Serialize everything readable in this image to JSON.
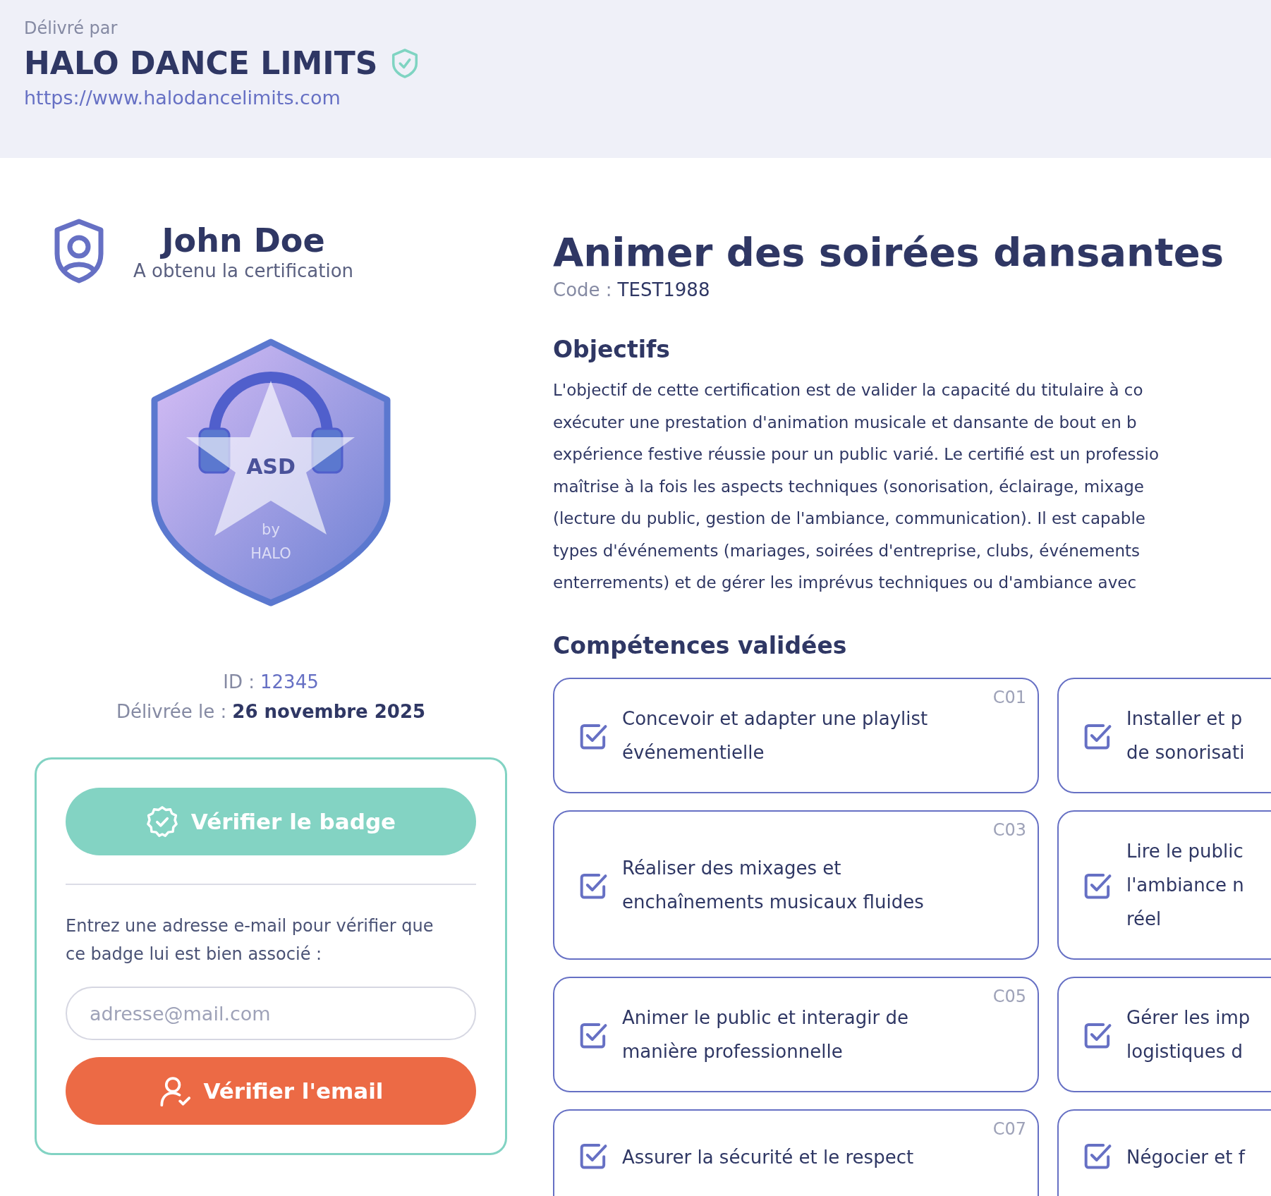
{
  "issuer": {
    "label": "Délivré par",
    "name": "HALO DANCE LIMITS",
    "verified": true,
    "url": "https://www.halodancelimits.com"
  },
  "recipient": {
    "name": "John Doe",
    "subtitle": "A obtenu la certification"
  },
  "badge": {
    "title": "ASD",
    "by": "by",
    "org": "HALO"
  },
  "details": [
    {
      "label": "ID :",
      "value": "12345",
      "kind": "link"
    },
    {
      "label": "Délivrée le :",
      "value": "26 novembre 2025",
      "kind": "strong"
    }
  ],
  "verify_panel": {
    "verify_button": "Vérifier le badge",
    "prompt": "Entrez une adresse e-mail pour vérifier que ce badge lui est bien associé :",
    "email_field": {
      "placeholder": "adresse@mail.com"
    },
    "email_button": "Vérifier l'email"
  },
  "certification": {
    "title": "Animer des soirées dansantes",
    "code_label": "Code :",
    "code": "TEST1988"
  },
  "objectives": {
    "heading": "Objectifs",
    "lines": [
      "L'objectif de cette certification est de valider la capacité du titulaire à co",
      "exécuter une prestation d'animation musicale et dansante de bout en b",
      "expérience festive réussie pour un public varié. Le certifié est un professio",
      "maîtrise à la fois les aspects techniques (sonorisation, éclairage, mixage",
      "(lecture du public, gestion de l'ambiance, communication). Il est capable",
      "types d'événements (mariages, soirées d'entreprise, clubs, événements",
      "enterrements) et de gérer les imprévus techniques ou d'ambiance avec"
    ]
  },
  "competencies": {
    "heading": "Compétences validées",
    "items": [
      {
        "code": "C01",
        "lines": [
          "Concevoir et adapter une playlist",
          "événementielle"
        ],
        "checked": true
      },
      {
        "lines": [
          "Installer et p",
          "de sonorisati"
        ],
        "checked": true
      },
      {
        "code": "C03",
        "lines": [
          "Réaliser des mixages et",
          "enchaînements musicaux fluides"
        ],
        "checked": true
      },
      {
        "lines": [
          "Lire le public",
          "l'ambiance n",
          "réel"
        ],
        "checked": true
      },
      {
        "code": "C05",
        "lines": [
          "Animer le public et interagir de",
          "manière professionnelle"
        ],
        "checked": true
      },
      {
        "lines": [
          "Gérer les imp",
          "logistiques d"
        ],
        "checked": true
      },
      {
        "code": "C07",
        "lines": [
          "Assurer la sécurité et le respect"
        ],
        "checked": true
      },
      {
        "lines": [
          "Négocier et f"
        ],
        "checked": true
      }
    ]
  }
}
